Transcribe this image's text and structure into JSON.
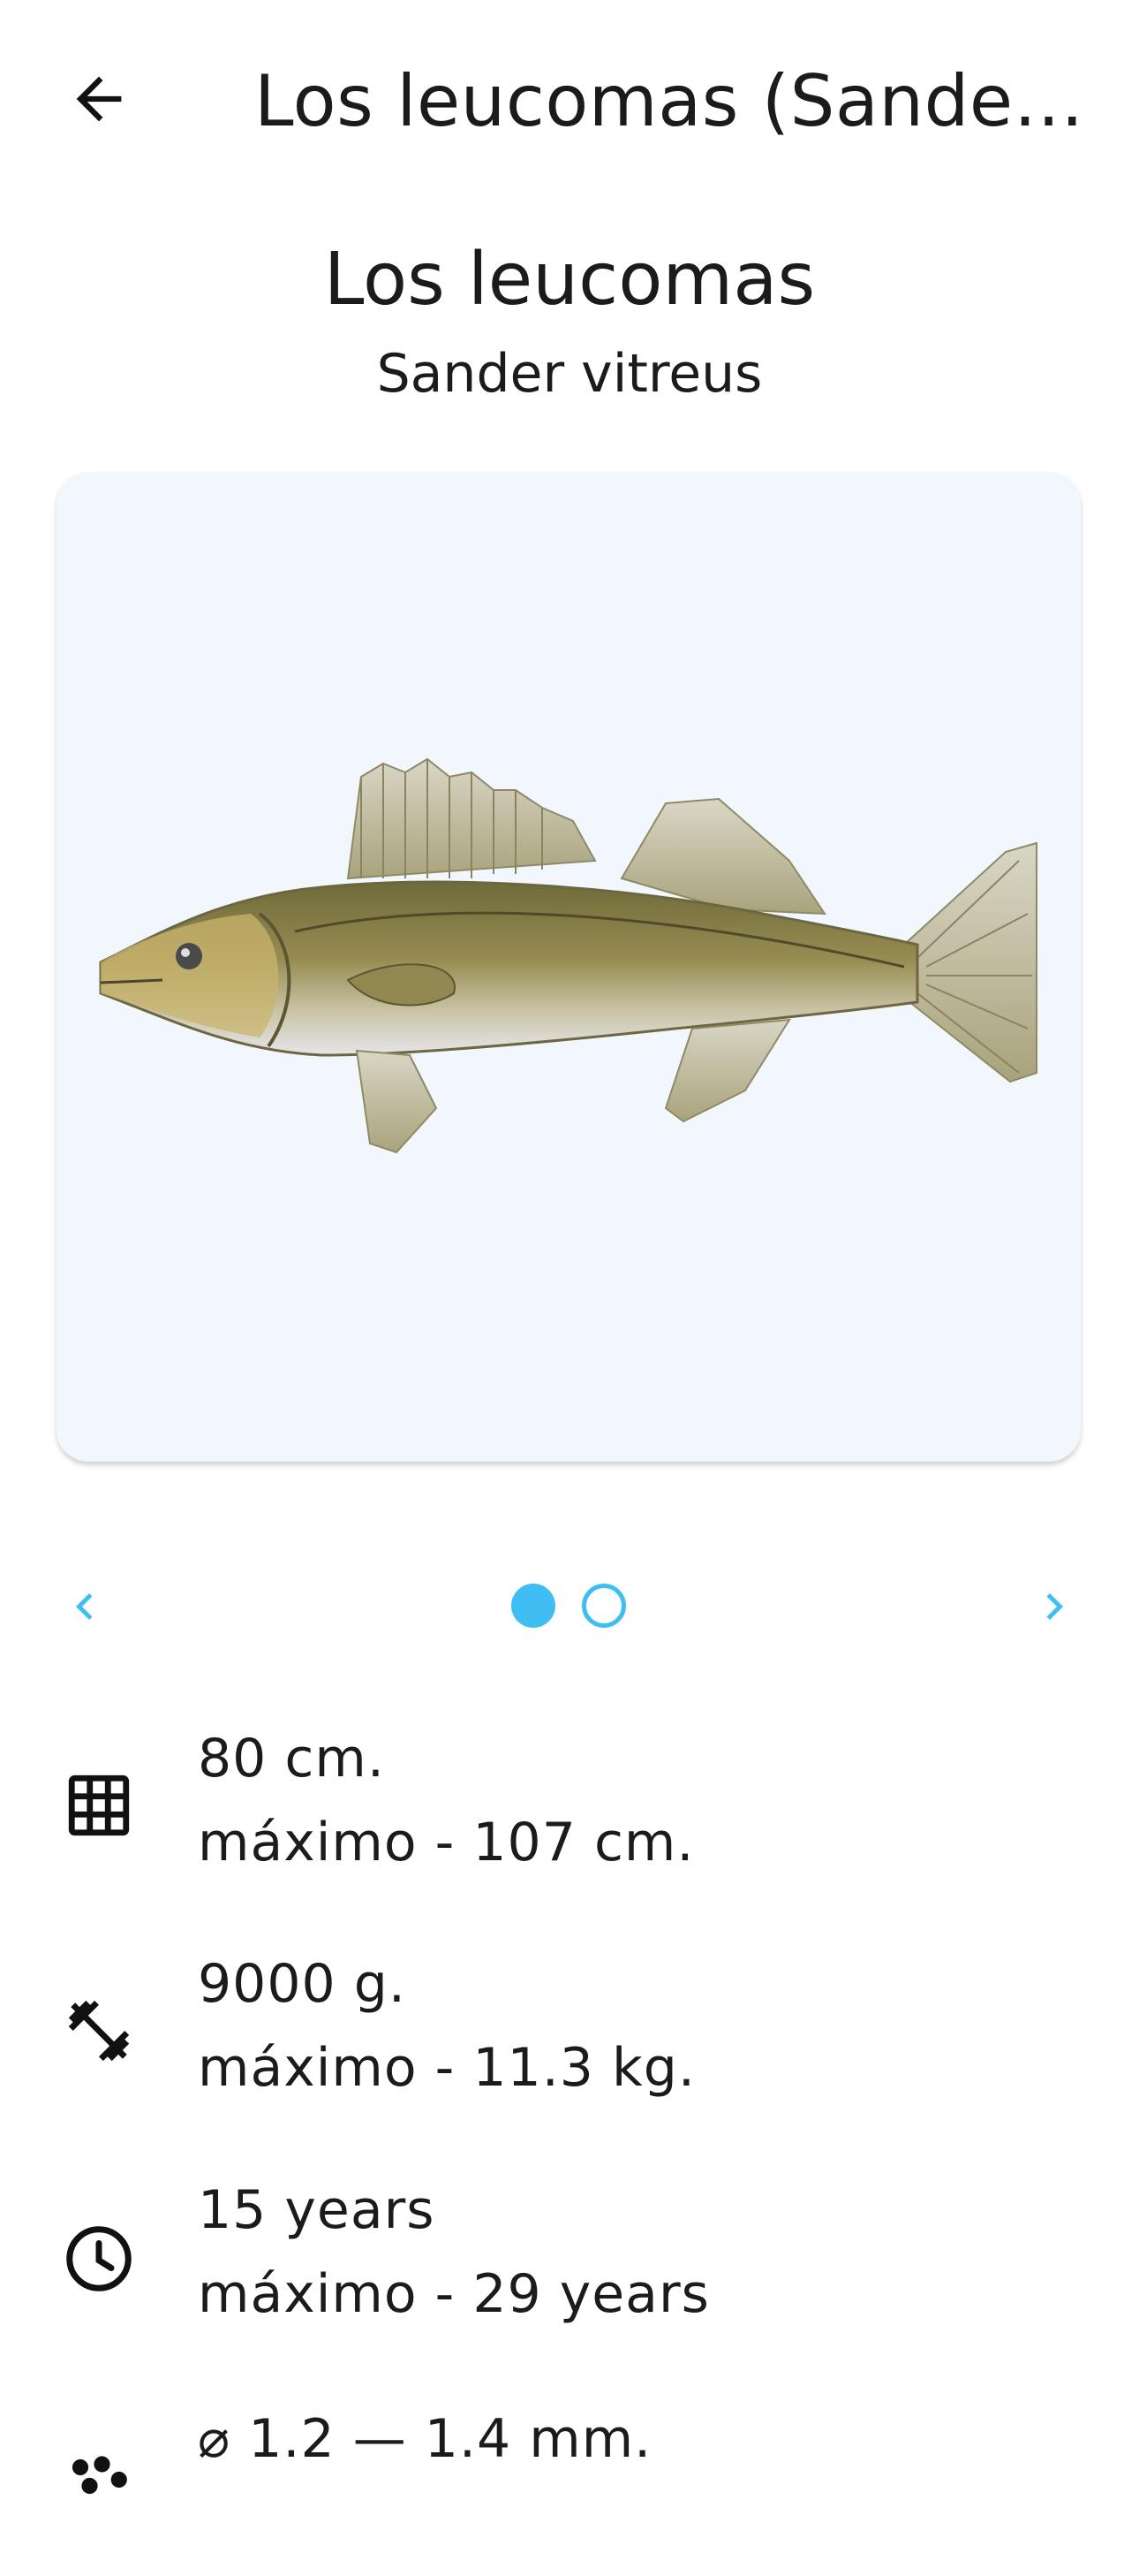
{
  "appbar": {
    "title": "Los leucomas (Sande…",
    "back_icon": "arrow-back-icon"
  },
  "species": {
    "name": "Los leucomas",
    "scientific": "Sander vitreus"
  },
  "gallery": {
    "image_subject": "fish-illustration",
    "pages": 2,
    "current_page": 1,
    "colors": {
      "card_bg": "#f1f7fd",
      "accent": "#3ebef3"
    }
  },
  "stats": [
    {
      "icon": "grid-icon",
      "value": "80 cm.",
      "max": "máximo - 107 cm."
    },
    {
      "icon": "dumbbell-icon",
      "value": "9000 g.",
      "max": "máximo - 11.3 kg."
    },
    {
      "icon": "clock-icon",
      "value": "15 years",
      "max": "máximo - 29 years"
    },
    {
      "icon": "eggs-icon",
      "value": "⌀ 1.2 — 1.4 mm.",
      "max": ""
    }
  ]
}
